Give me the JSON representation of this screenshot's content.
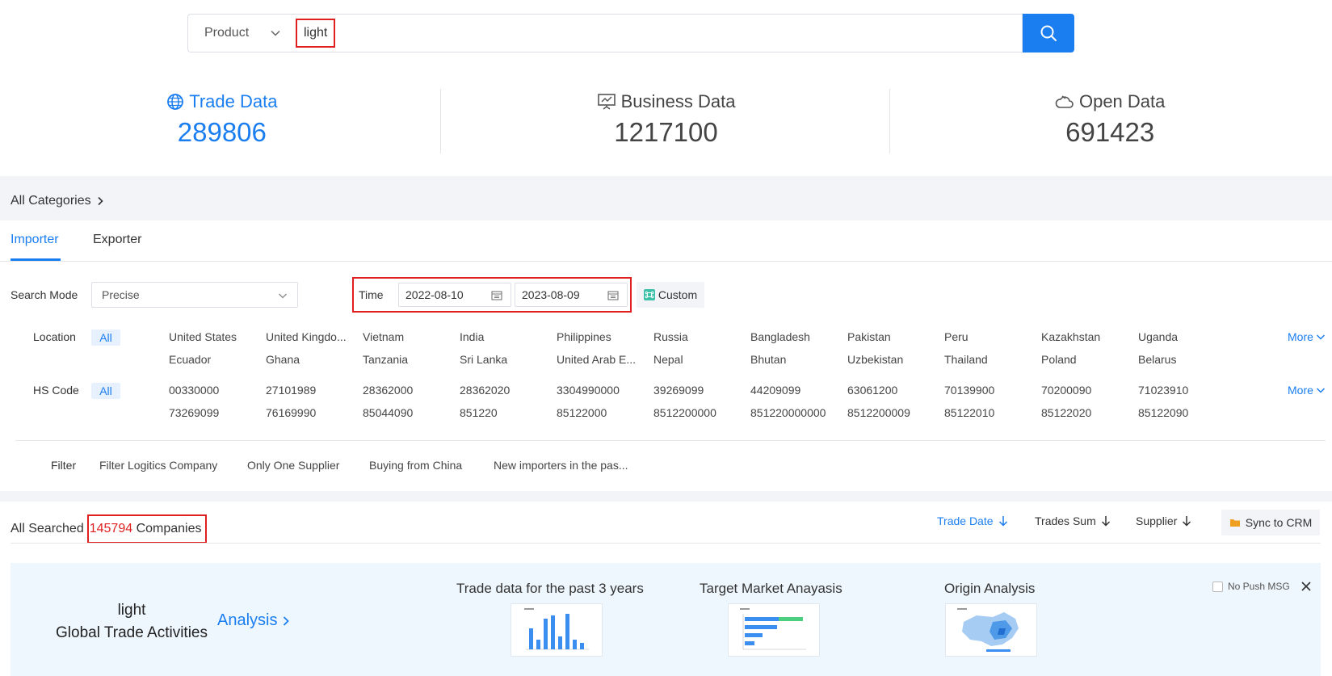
{
  "search": {
    "type_label": "Product",
    "query": "light"
  },
  "stats": [
    {
      "label": "Trade Data",
      "value": "289806",
      "icon": "globe-icon"
    },
    {
      "label": "Business Data",
      "value": "1217100",
      "icon": "presentation-icon"
    },
    {
      "label": "Open Data",
      "value": "691423",
      "icon": "cloud-icon"
    }
  ],
  "categories_label": "All Categories",
  "tabs": [
    {
      "label": "Importer"
    },
    {
      "label": "Exporter"
    }
  ],
  "search_mode": {
    "label": "Search Mode",
    "value": "Precise"
  },
  "time": {
    "label": "Time",
    "start": "2022-08-10",
    "end": "2023-08-09",
    "custom_label": "Custom"
  },
  "location": {
    "label": "Location",
    "all_label": "All",
    "more_label": "More",
    "row1": [
      "United States",
      "United Kingdo...",
      "Vietnam",
      "India",
      "Philippines",
      "Russia",
      "Bangladesh",
      "Pakistan",
      "Peru",
      "Kazakhstan",
      "Uganda"
    ],
    "row2": [
      "Ecuador",
      "Ghana",
      "Tanzania",
      "Sri Lanka",
      "United Arab E...",
      "Nepal",
      "Bhutan",
      "Uzbekistan",
      "Thailand",
      "Poland",
      "Belarus"
    ]
  },
  "hs_code": {
    "label": "HS Code",
    "all_label": "All",
    "more_label": "More",
    "row1": [
      "00330000",
      "27101989",
      "28362000",
      "28362020",
      "3304990000",
      "39269099",
      "44209099",
      "63061200",
      "70139900",
      "70200090",
      "71023910"
    ],
    "row2": [
      "73269099",
      "76169990",
      "85044090",
      "851220",
      "85122000",
      "8512200000",
      "851220000000",
      "8512200009",
      "85122010",
      "85122020",
      "85122090"
    ]
  },
  "filter": {
    "label": "Filter",
    "items": [
      "Filter Logitics Company",
      "Only One Supplier",
      "Buying from China",
      "New importers in the pas..."
    ]
  },
  "results": {
    "prefix": "All Searched",
    "count": "145794",
    "suffix": "Companies",
    "sorts": [
      "Trade Date",
      "Trades Sum",
      "Supplier"
    ],
    "sync_label": "Sync to CRM"
  },
  "analysis_panel": {
    "keyword": "light",
    "subtitle": "Global Trade Activities",
    "link_label": "Analysis",
    "thumbs": [
      {
        "title": "Trade data for the past 3 years"
      },
      {
        "title": "Target Market Anayasis"
      },
      {
        "title": "Origin Analysis"
      }
    ],
    "no_push_label": "No Push MSG"
  },
  "colors": {
    "accent": "#1a7ef0",
    "highlight": "#e02020",
    "band": "#f2f4f8"
  }
}
